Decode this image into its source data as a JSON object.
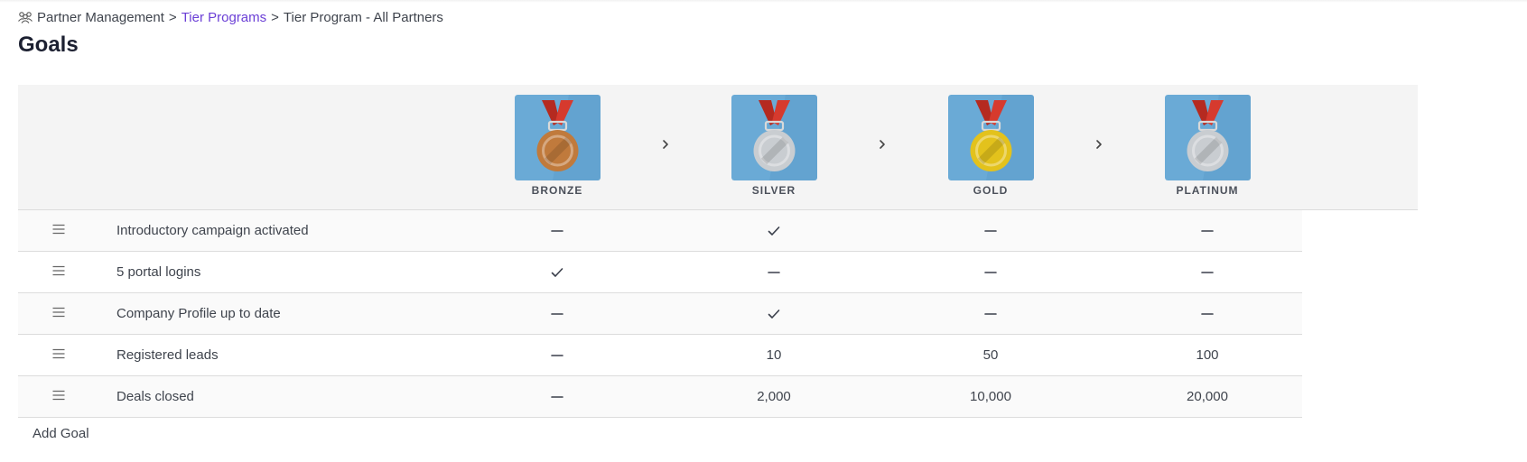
{
  "breadcrumb": {
    "icon": "partners-icon",
    "root": "Partner Management",
    "separator": ">",
    "parent": "Tier Programs",
    "current": "Tier Program - All Partners"
  },
  "page_title": "Goals",
  "tiers": [
    {
      "label": "BRONZE",
      "icon": "bronze-medal-icon",
      "medal_color": "#c07a3c"
    },
    {
      "label": "SILVER",
      "icon": "silver-medal-icon",
      "medal_color": "#c9cdd1"
    },
    {
      "label": "GOLD",
      "icon": "gold-medal-icon",
      "medal_color": "#e3c21c"
    },
    {
      "label": "PLATINUM",
      "icon": "platinum-medal-icon",
      "medal_color": "#c9cdd1"
    }
  ],
  "goals": [
    {
      "name": "Introductory campaign activated",
      "values": [
        "–",
        "✓",
        "–",
        "–"
      ]
    },
    {
      "name": "5 portal logins",
      "values": [
        "✓",
        "–",
        "–",
        "–"
      ]
    },
    {
      "name": "Company Profile up to date",
      "values": [
        "–",
        "✓",
        "–",
        "–"
      ]
    },
    {
      "name": "Registered leads",
      "values": [
        "–",
        "10",
        "50",
        "100"
      ]
    },
    {
      "name": "Deals closed",
      "values": [
        "–",
        "2,000",
        "10,000",
        "20,000"
      ]
    }
  ],
  "add_goal_label": "Add Goal",
  "colors": {
    "link": "#6b3fd6",
    "badge_background": "#6aaad6",
    "ribbon": "#d63a2e",
    "header_background": "#f4f4f4"
  }
}
